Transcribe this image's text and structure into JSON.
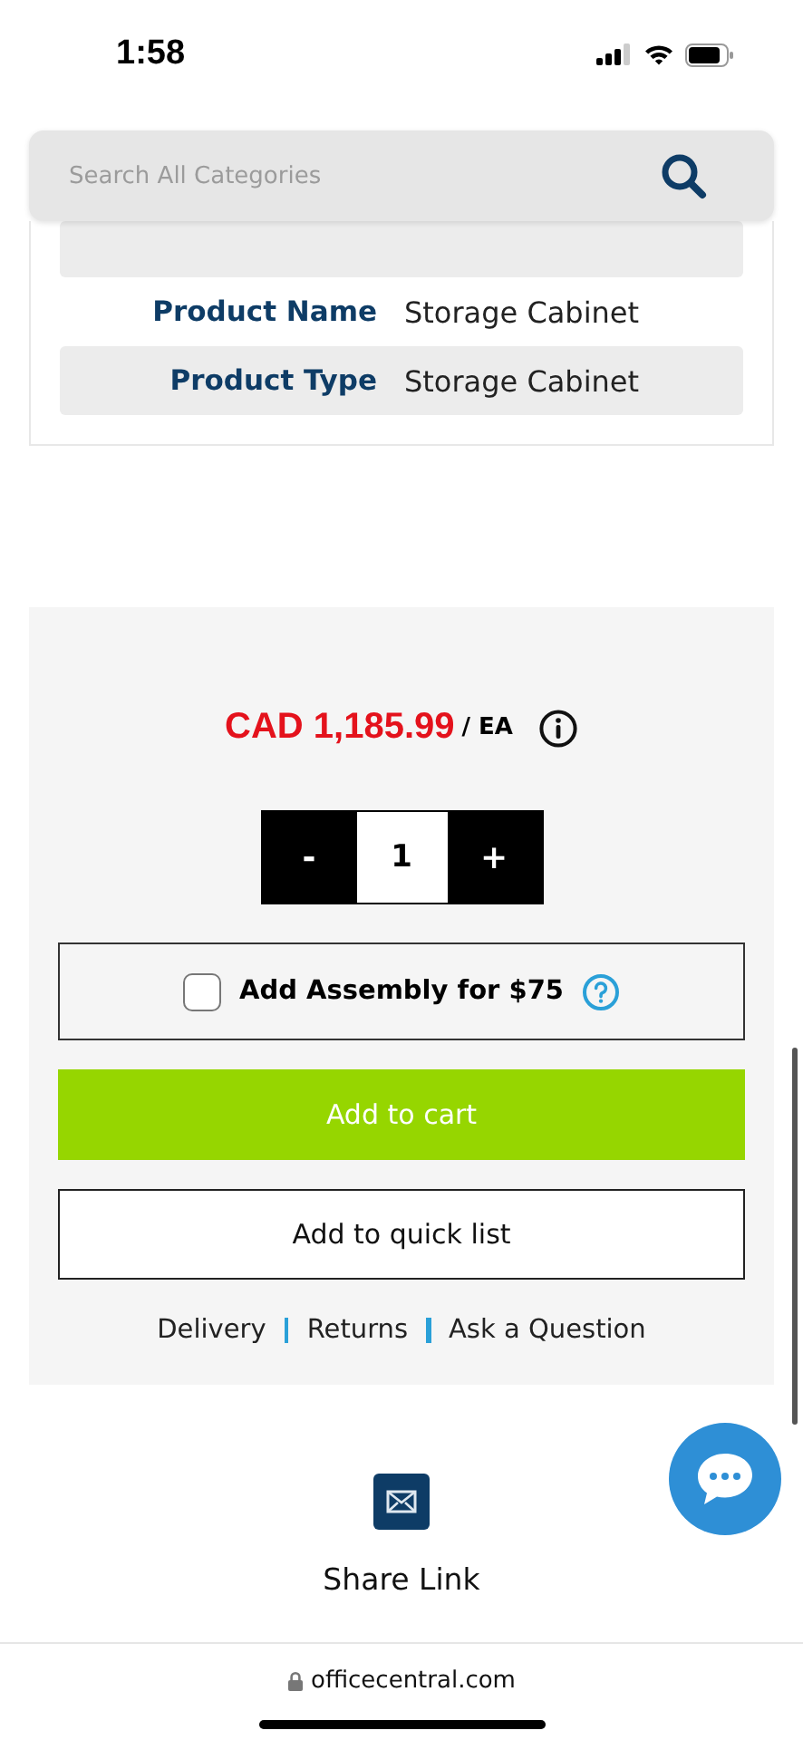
{
  "status_bar": {
    "time": "1:58"
  },
  "search": {
    "placeholder": "Search All Categories"
  },
  "specs": [
    {
      "label": "Product Name",
      "value": "Storage Cabinet"
    },
    {
      "label": "Product Type",
      "value": "Storage Cabinet"
    }
  ],
  "purchase": {
    "price": "CAD 1,185.99",
    "unit": "/ EA",
    "quantity": "1",
    "minus": "-",
    "plus": "+",
    "assembly": {
      "label": "Add Assembly for $75",
      "checked": false
    },
    "add_to_cart": "Add to cart",
    "quick_list": "Add to quick list",
    "links": [
      "Delivery",
      "Returns",
      "Ask a Question"
    ]
  },
  "share": {
    "label": "Share Link"
  },
  "browser": {
    "url": "officecentral.com"
  }
}
